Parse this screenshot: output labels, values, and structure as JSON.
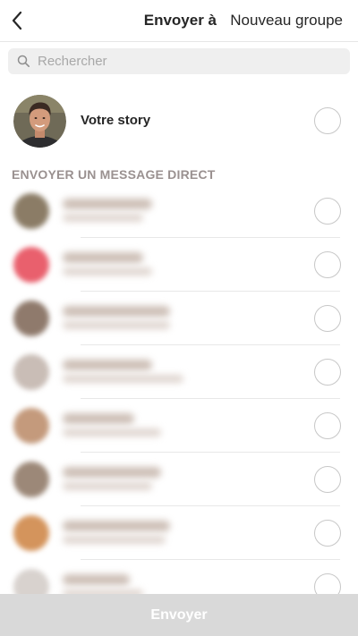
{
  "header": {
    "title": "Envoyer à",
    "new_group_label": "Nouveau groupe",
    "back_icon": "chevron-left-icon"
  },
  "search": {
    "placeholder": "Rechercher",
    "value": "",
    "icon": "search-icon"
  },
  "story": {
    "label": "Votre story",
    "selected": false
  },
  "direct": {
    "heading": "ENVOYER UN MESSAGE DIRECT",
    "contacts": [
      {
        "avatar_color": "#8b7c66",
        "selected": false
      },
      {
        "avatar_color": "#e9606d",
        "selected": false
      },
      {
        "avatar_color": "#8f7a6c",
        "selected": false
      },
      {
        "avatar_color": "#c9bdb6",
        "selected": false
      },
      {
        "avatar_color": "#c49a7c",
        "selected": false
      },
      {
        "avatar_color": "#9c8878",
        "selected": false
      },
      {
        "avatar_color": "#d4945c",
        "selected": false
      },
      {
        "avatar_color": "#d8d2ce",
        "selected": false
      }
    ]
  },
  "footer": {
    "send_label": "Envoyer",
    "enabled": false
  },
  "colors": {
    "footer_bg": "#d9d9d9",
    "section_heading": "#9a9190",
    "radio_border": "#c7c7c7"
  }
}
